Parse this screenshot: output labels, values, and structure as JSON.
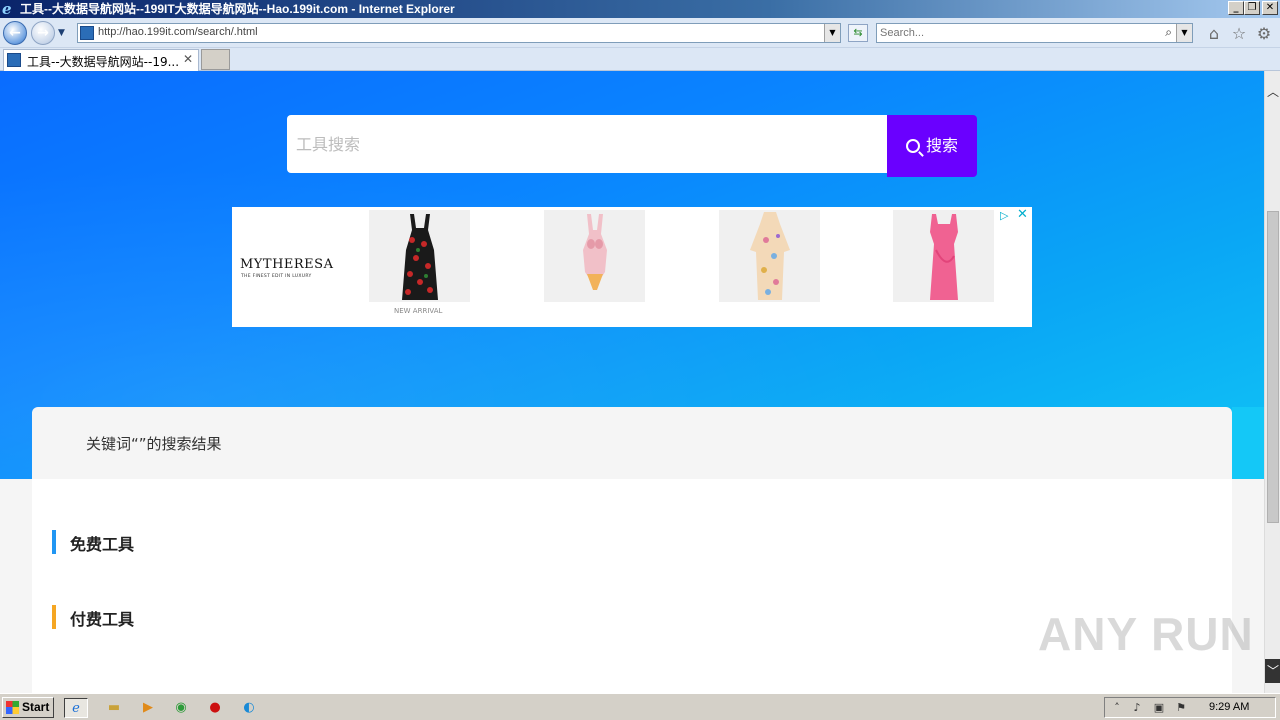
{
  "window": {
    "title": "工具--大数据导航网站--199IT大数据导航网站--Hao.199it.com - Internet Explorer",
    "minimize": "_",
    "restore": "❐",
    "close": "✕"
  },
  "navbar": {
    "url": "http://hao.199it.com/search/.html",
    "search_placeholder": "Search..."
  },
  "tabs": [
    {
      "label": "工具--大数据导航网站--19...",
      "close": "✕"
    }
  ],
  "page": {
    "search_placeholder": "工具搜索",
    "search_button": "搜索",
    "ad": {
      "brand": "MYTHERESA",
      "tagline": "THE FINEST EDIT IN LUXURY",
      "product_caption": "NEW ARRIVAL",
      "close": "✕"
    },
    "results_heading": "关键词“”的搜索结果",
    "categories": [
      {
        "label": "免费工具",
        "color": "#2196f3"
      },
      {
        "label": "付费工具",
        "color": "#f5a623"
      }
    ]
  },
  "watermark": "ANY  RUN",
  "taskbar": {
    "start_label": "Start",
    "time": "9:29 AM"
  },
  "colors": {
    "search_button": "#6a00ff",
    "hero_blue": "#0a84ff",
    "ad_accent": "#00aecd"
  }
}
